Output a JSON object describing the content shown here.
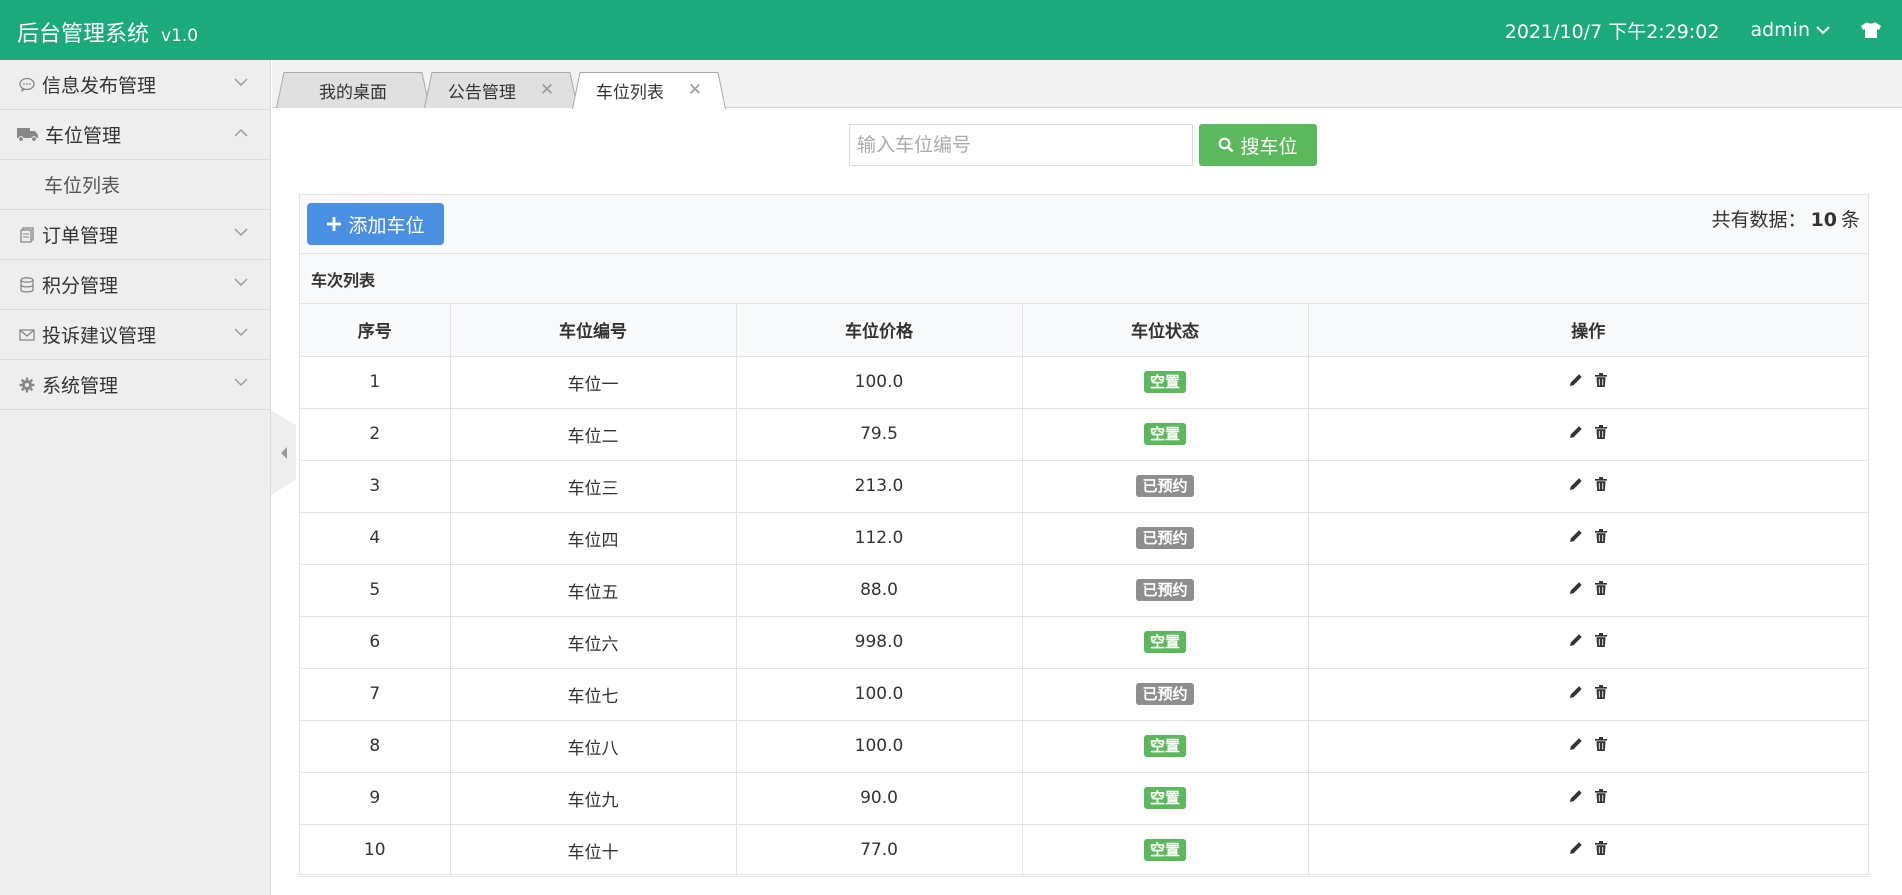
{
  "header": {
    "title": "后台管理系统",
    "version": "v1.0",
    "datetime": "2021/10/7 下午2:29:02",
    "user": "admin",
    "colors": {
      "header_bg": "#1aaa7b"
    }
  },
  "sidebar": {
    "items": [
      {
        "label": "信息发布管理",
        "icon": "comment-icon"
      },
      {
        "label": "车位管理",
        "icon": "truck-icon",
        "expanded": true,
        "children": [
          {
            "label": "车位列表"
          }
        ]
      },
      {
        "label": "订单管理",
        "icon": "document-icon"
      },
      {
        "label": "积分管理",
        "icon": "database-icon"
      },
      {
        "label": "投诉建议管理",
        "icon": "envelope-icon"
      },
      {
        "label": "系统管理",
        "icon": "gear-icon"
      }
    ]
  },
  "tabs": [
    {
      "label": "我的桌面",
      "closable": false
    },
    {
      "label": "公告管理",
      "closable": true
    },
    {
      "label": "车位列表",
      "closable": true,
      "active": true
    }
  ],
  "search": {
    "placeholder": "输入车位编号",
    "button_label": "搜车位"
  },
  "toolbar": {
    "add_label": "添加车位",
    "count_prefix": "共有数据：",
    "count_value": "10",
    "count_suffix": "条"
  },
  "list_title": "车次列表",
  "table": {
    "columns": [
      "序号",
      "车位编号",
      "车位价格",
      "车位状态",
      "操作"
    ],
    "rows": [
      {
        "no": "1",
        "code": "车位一",
        "price": "100.0",
        "status": "空置",
        "status_type": "free"
      },
      {
        "no": "2",
        "code": "车位二",
        "price": "79.5",
        "status": "空置",
        "status_type": "free"
      },
      {
        "no": "3",
        "code": "车位三",
        "price": "213.0",
        "status": "已预约",
        "status_type": "booked"
      },
      {
        "no": "4",
        "code": "车位四",
        "price": "112.0",
        "status": "已预约",
        "status_type": "booked"
      },
      {
        "no": "5",
        "code": "车位五",
        "price": "88.0",
        "status": "已预约",
        "status_type": "booked"
      },
      {
        "no": "6",
        "code": "车位六",
        "price": "998.0",
        "status": "空置",
        "status_type": "free"
      },
      {
        "no": "7",
        "code": "车位七",
        "price": "100.0",
        "status": "已预约",
        "status_type": "booked"
      },
      {
        "no": "8",
        "code": "车位八",
        "price": "100.0",
        "status": "空置",
        "status_type": "free"
      },
      {
        "no": "9",
        "code": "车位九",
        "price": "90.0",
        "status": "空置",
        "status_type": "free"
      },
      {
        "no": "10",
        "code": "车位十",
        "price": "77.0",
        "status": "空置",
        "status_type": "free"
      }
    ]
  },
  "colors": {
    "free_badge": "#5cb85c",
    "booked_badge": "#8e8e8e",
    "search_button": "#5cb85c",
    "add_button": "#4a90e2"
  }
}
